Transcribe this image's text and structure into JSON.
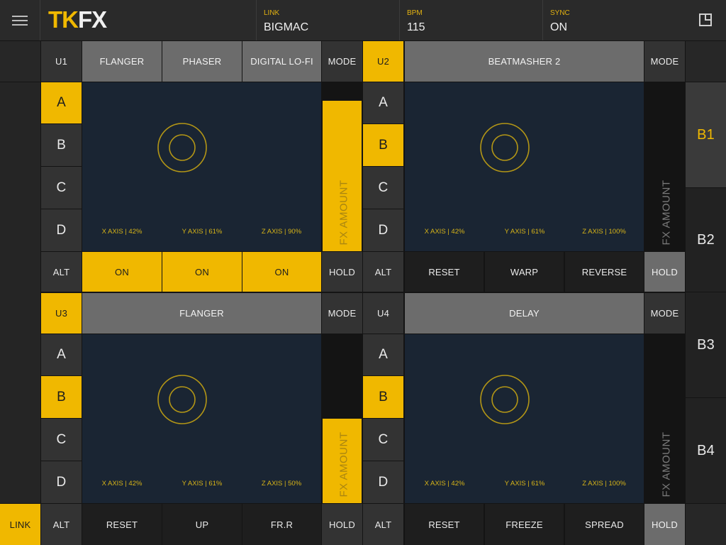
{
  "app": {
    "logo_left": "TK",
    "logo_right": "FX"
  },
  "header": {
    "link": {
      "label": "LINK",
      "value": "BIGMAC"
    },
    "bpm": {
      "label": "BPM",
      "value": "115"
    },
    "sync": {
      "label": "SYNC",
      "value": "ON"
    }
  },
  "units": {
    "u1": {
      "label": "U1",
      "effects": [
        "FLANGER",
        "PHASER",
        "DIGITAL LO-FI"
      ],
      "mode": "MODE",
      "banks": [
        "A",
        "B",
        "C",
        "D"
      ],
      "selected_bank": "A",
      "axes": [
        "X AXIS | 42%",
        "Y AXIS | 61%",
        "Z AXIS | 90%"
      ],
      "fx_amount_label": "FX AMOUNT",
      "fx_amount_level": 0.89,
      "alt": "ALT",
      "buttons": [
        "ON",
        "ON",
        "ON"
      ],
      "hold": "HOLD"
    },
    "u2": {
      "label": "U2",
      "effects": [
        "BEATMASHER 2"
      ],
      "mode": "MODE",
      "banks": [
        "A",
        "B",
        "C",
        "D"
      ],
      "selected_bank": "B",
      "axes": [
        "X AXIS | 42%",
        "Y AXIS | 61%",
        "Z AXIS | 100%"
      ],
      "fx_amount_label": "FX AMOUNT",
      "fx_amount_level": 0,
      "alt": "ALT",
      "buttons": [
        "RESET",
        "WARP",
        "REVERSE"
      ],
      "hold": "HOLD"
    },
    "u3": {
      "label": "U3",
      "effects": [
        "FLANGER"
      ],
      "mode": "MODE",
      "banks": [
        "A",
        "B",
        "C",
        "D"
      ],
      "selected_bank": "B",
      "axes": [
        "X AXIS | 42%",
        "Y AXIS | 61%",
        "Z AXIS | 50%"
      ],
      "fx_amount_label": "FX AMOUNT",
      "fx_amount_level": 0.5,
      "alt": "ALT",
      "buttons": [
        "RESET",
        "UP",
        "FR.R"
      ],
      "hold": "HOLD"
    },
    "u4": {
      "label": "U4",
      "effects": [
        "DELAY"
      ],
      "mode": "MODE",
      "banks": [
        "A",
        "B",
        "C",
        "D"
      ],
      "selected_bank": "B",
      "axes": [
        "X AXIS | 42%",
        "Y AXIS | 61%",
        "Z AXIS | 100%"
      ],
      "fx_amount_label": "FX AMOUNT",
      "fx_amount_level": 0,
      "alt": "ALT",
      "buttons": [
        "RESET",
        "FREEZE",
        "SPREAD"
      ],
      "hold": "HOLD"
    }
  },
  "right_banks": [
    "B1",
    "B2",
    "B3",
    "B4"
  ],
  "selected_right_bank": "B1",
  "link_button": "LINK",
  "colors": {
    "accent": "#f0b800",
    "pad": "#1a2533",
    "background": "#141414"
  }
}
